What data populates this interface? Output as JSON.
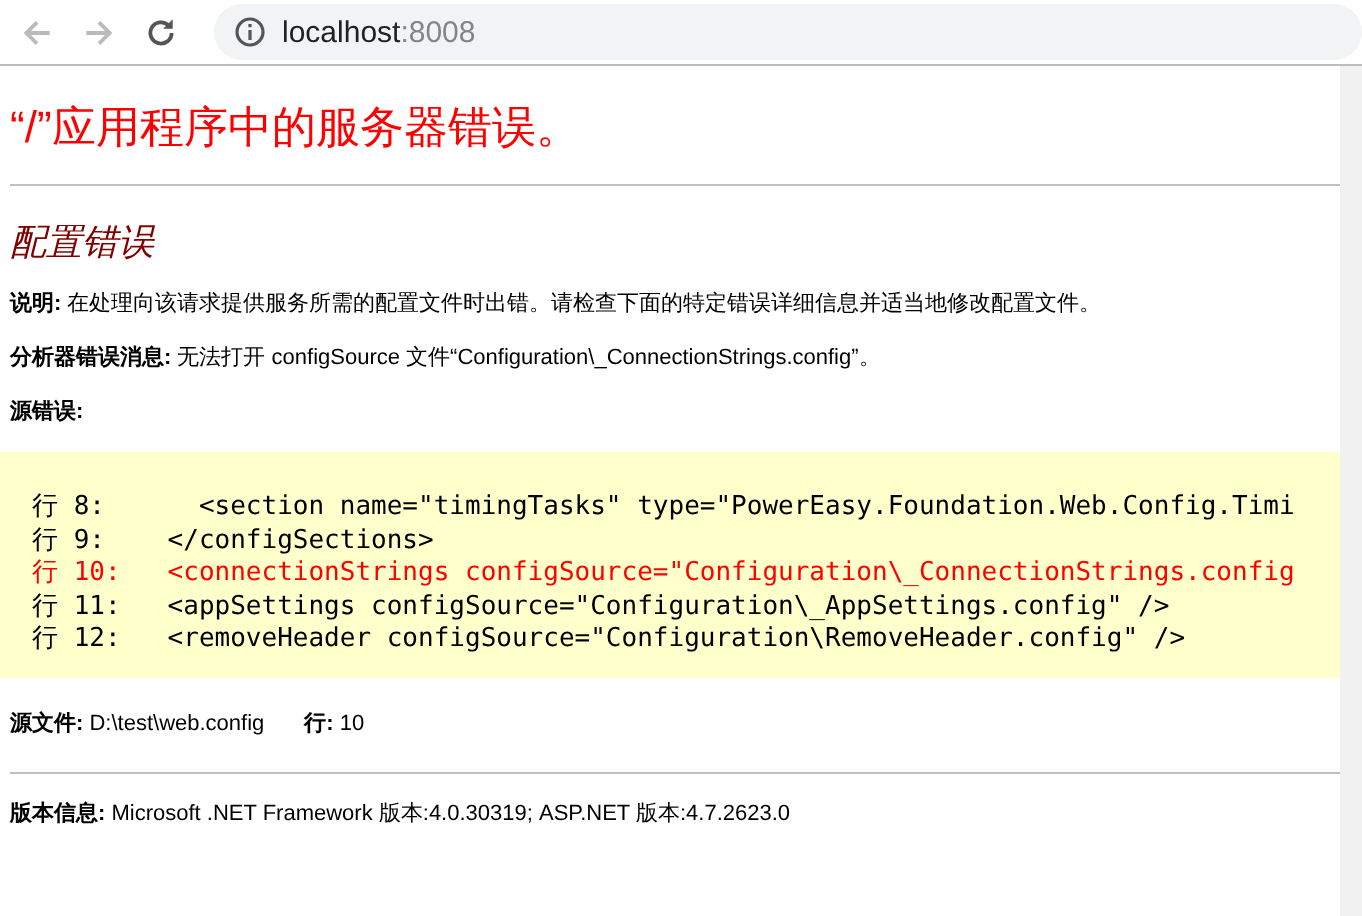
{
  "browser": {
    "address_host": "localhost",
    "address_port": ":8008"
  },
  "page": {
    "title": "“/”应用程序中的服务器错误。",
    "subtitle": "配置错误",
    "description": {
      "label": "说明:",
      "text": "在处理向该请求提供服务所需的配置文件时出错。请检查下面的特定错误详细信息并适当地修改配置文件。"
    },
    "parser_message": {
      "label": "分析器错误消息:",
      "text": "无法打开 configSource 文件“Configuration\\_ConnectionStrings.config”。"
    },
    "source_error": {
      "label": "源错误:"
    },
    "code_lines": [
      {
        "text": "行 8:      <section name=\"timingTasks\" type=\"PowerEasy.Foundation.Web.Config.Timi",
        "highlighted": false
      },
      {
        "text": "行 9:    </configSections>",
        "highlighted": false
      },
      {
        "text": "行 10:   <connectionStrings configSource=\"Configuration\\_ConnectionStrings.config",
        "highlighted": true
      },
      {
        "text": "行 11:   <appSettings configSource=\"Configuration\\_AppSettings.config\" />",
        "highlighted": false
      },
      {
        "text": "行 12:   <removeHeader configSource=\"Configuration\\RemoveHeader.config\" />",
        "highlighted": false
      }
    ],
    "source_file": {
      "label": "源文件:",
      "text": "D:\\test\\web.config",
      "line_label": "行:",
      "line": "10"
    },
    "version": {
      "label": "版本信息:",
      "text": "Microsoft .NET Framework 版本:4.0.30319; ASP.NET 版本:4.7.2623.0"
    }
  }
}
